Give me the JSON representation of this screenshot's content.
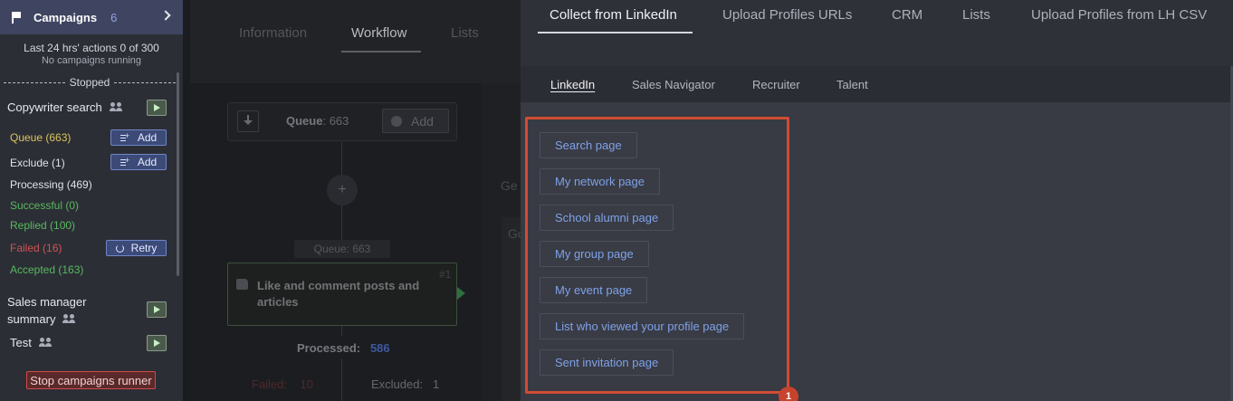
{
  "sidebar": {
    "title": "Campaigns",
    "count": "6",
    "actions_text": "Last 24 hrs' actions 0 of 300",
    "running_text": "No campaigns running",
    "stopped_label": "Stopped",
    "campaigns": [
      {
        "name": "Copywriter search"
      },
      {
        "name_line1": "Sales manager",
        "name_line2": "summary"
      },
      {
        "name": "Test"
      }
    ],
    "stats": {
      "queue": "Queue (663)",
      "exclude": "Exclude (1)",
      "processing": "Processing (469)",
      "successful": "Successful (0)",
      "replied": "Replied (100)",
      "failed": "Failed (16)",
      "accepted": "Accepted (163)"
    },
    "add_label": "Add",
    "retry_label": "Retry",
    "stop_runner_label": "Stop campaigns runner"
  },
  "workflow": {
    "tabs": [
      "Information",
      "Workflow",
      "Lists"
    ],
    "queue_label": "Queue",
    "queue_count": ": 663",
    "add_label": "Add",
    "queue2_text": "Queue:   663",
    "node_title": "Like and comment posts and articles",
    "node_number": "#1",
    "processed_label": "Processed:",
    "processed_value": "586",
    "failed_label": "Failed:",
    "failed_value": "10",
    "excluded_label": "Excluded:",
    "excluded_value": "1",
    "partial_ge": "Ge",
    "partial_go": "Go"
  },
  "panel": {
    "tabs": [
      "Collect from LinkedIn",
      "Upload Profiles URLs",
      "CRM",
      "Lists",
      "Upload Profiles from LH CSV"
    ],
    "subtabs": [
      "LinkedIn",
      "Sales Navigator",
      "Recruiter",
      "Talent"
    ],
    "page_buttons": [
      "Search page",
      "My network page",
      "School alumni page",
      "My group page",
      "My event page",
      "List who viewed your profile page",
      "Sent invitation page"
    ],
    "badge": "1"
  },
  "colors": {
    "accent": "#7ea2e6",
    "highlight": "#d14c32",
    "sidebar_header": "#3f4560"
  }
}
